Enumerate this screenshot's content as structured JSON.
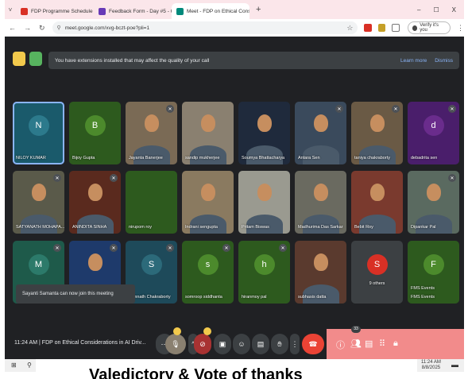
{
  "browser": {
    "tabs": [
      {
        "title": "FDP Programme Schedule and",
        "favicon_color": "#d93025",
        "active": false
      },
      {
        "title": "Feedback Form - Day #5 - Goo",
        "favicon_color": "#673ab7",
        "active": false
      },
      {
        "title": "Meet - FDP on Ethical Cons",
        "favicon_color": "#00897b",
        "active": true
      }
    ],
    "url": "meet.google.com/xvg-bczt-poe?pli=1",
    "profile_label": "Verify it's you",
    "window_controls": [
      "–",
      "☐",
      "X"
    ]
  },
  "banner": {
    "message": "You have extensions installed that may affect the quality of your call",
    "learn_more": "Learn more",
    "dismiss": "Dismiss"
  },
  "participants": [
    {
      "name": "NILOY KUMAR",
      "initial": "N",
      "bg": "#1a5a6b",
      "avatar_color": "#2c7a8c",
      "video": false,
      "muted": false,
      "selected": true
    },
    {
      "name": "Bijoy Gupta",
      "initial": "B",
      "bg": "#2d5a1e",
      "avatar_color": "#4c8a2c",
      "video": false,
      "muted": false
    },
    {
      "name": "Jayanta Banerjee",
      "initial": "",
      "bg": "#7a6a55",
      "video": true,
      "muted": true
    },
    {
      "name": "sandip mukherjee",
      "initial": "",
      "bg": "#8a8070",
      "video": true,
      "muted": false
    },
    {
      "name": "Soumya Bhattacharya",
      "initial": "",
      "bg": "#1f2a3c",
      "video": true,
      "muted": false
    },
    {
      "name": "Antara Sen",
      "initial": "",
      "bg": "#3a4a5c",
      "video": true,
      "muted": true
    },
    {
      "name": "taniya chakraborty",
      "initial": "",
      "bg": "#6a5a45",
      "video": true,
      "muted": true
    },
    {
      "name": "debadrita sen",
      "initial": "d",
      "bg": "#4a1e6b",
      "avatar_color": "#6a2c8c",
      "video": false,
      "muted": true
    },
    {
      "name": "SATYANATH MOHAPA...",
      "initial": "",
      "bg": "#5a5a4a",
      "video": true,
      "muted": true
    },
    {
      "name": "ANINDITA SINHA",
      "initial": "",
      "bg": "#5a2a1e",
      "video": true,
      "muted": true
    },
    {
      "name": "nirupom roy",
      "initial": "",
      "bg": "#2d5a1e",
      "video": false,
      "muted": false
    },
    {
      "name": "Indrani sengupta",
      "initial": "",
      "bg": "#8a7a60",
      "video": true,
      "muted": false
    },
    {
      "name": "Pritam Biswas",
      "initial": "",
      "bg": "#9a9a90",
      "video": true,
      "muted": false
    },
    {
      "name": "Madhurima Das Sarkar",
      "initial": "",
      "bg": "#6a6a60",
      "video": true,
      "muted": false
    },
    {
      "name": "Bebit Roy",
      "initial": "",
      "bg": "#7a3a2e",
      "video": true,
      "muted": false
    },
    {
      "name": "Dipankar Pal",
      "initial": "",
      "bg": "#5a6a60",
      "video": true,
      "muted": true
    },
    {
      "name": "M",
      "initial": "M",
      "bg": "#1e5a4a",
      "avatar_color": "#2c7a6a",
      "video": false,
      "muted": true,
      "hide_name": true
    },
    {
      "name": "",
      "initial": "",
      "bg": "#1e3a6b",
      "video": true,
      "muted": true
    },
    {
      "name": "somnath Chakraborty",
      "initial": "S",
      "bg": "#1e4a5a",
      "avatar_color": "#2c6a7a",
      "video": false,
      "muted": true
    },
    {
      "name": "somroop siddhanta",
      "initial": "s",
      "bg": "#2d5a1e",
      "avatar_color": "#4c8a2c",
      "video": false,
      "muted": true
    },
    {
      "name": "hiranmoy pal",
      "initial": "h",
      "bg": "#2d5a1e",
      "avatar_color": "#4c8a2c",
      "video": false,
      "muted": true
    },
    {
      "name": "subhasis datta",
      "initial": "",
      "bg": "#5a3a2e",
      "video": true,
      "muted": false
    },
    {
      "name": "9 others",
      "initial": "S",
      "bg": "#3c4043",
      "avatar_color": "#d93025",
      "video": false,
      "muted": false,
      "others": true
    },
    {
      "name": "FMS Events",
      "initial": "F",
      "bg": "#2d5a1e",
      "avatar_color": "#4c8a2c",
      "video": false,
      "muted": false,
      "extra": "FMS Events"
    }
  ],
  "toast": "Sayanti Samanta can now join this meeting",
  "footer": {
    "time": "11:24 AM",
    "separator": "|",
    "meeting": "FDP on Ethical Considerations in AI Driv...",
    "participant_badge": "33",
    "controls": [
      "more",
      "mic",
      "caret",
      "camera",
      "present",
      "emoji",
      "captions",
      "hand",
      "options",
      "end-call"
    ],
    "right_controls": [
      "info",
      "people",
      "chat",
      "activities",
      "lock"
    ]
  },
  "taskbar": {
    "clock": "11:24 AM",
    "date": "8/8/2025"
  },
  "overlay_caption": "Valedictory & Vote of thanks"
}
